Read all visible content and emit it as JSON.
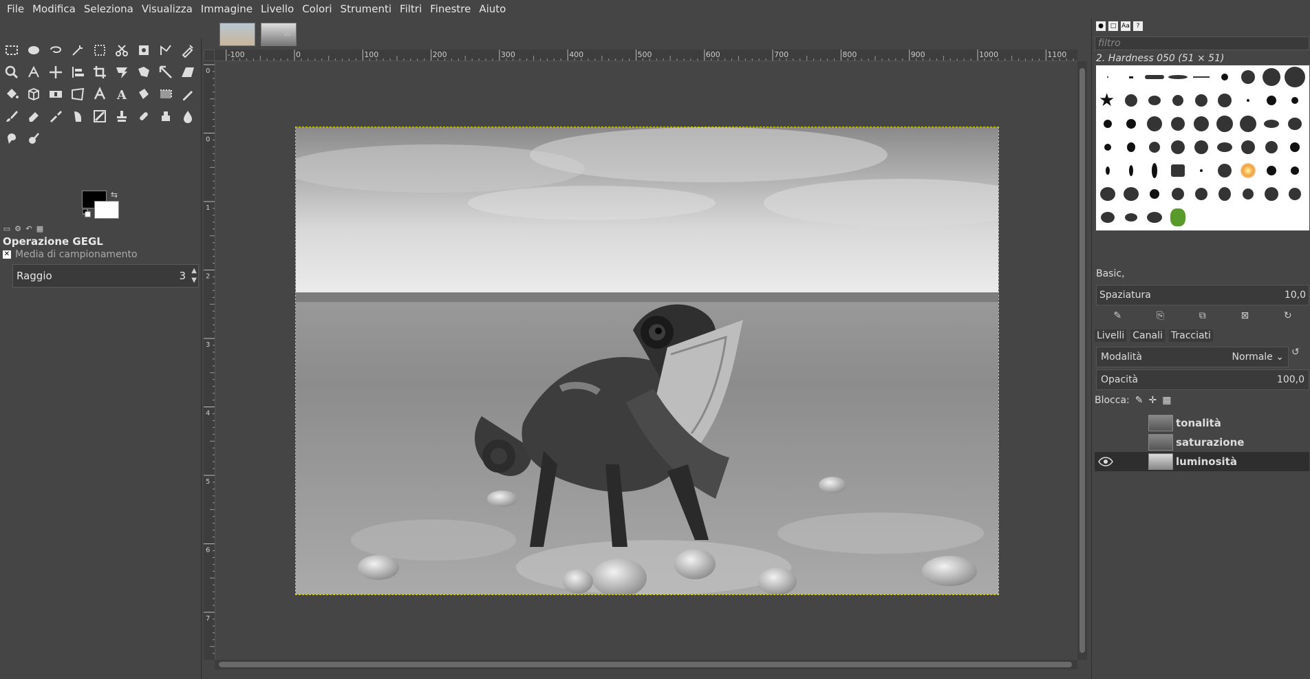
{
  "menu": [
    "File",
    "Modifica",
    "Seleziona",
    "Visualizza",
    "Immagine",
    "Livello",
    "Colori",
    "Strumenti",
    "Filtri",
    "Finestre",
    "Aiuto"
  ],
  "tool_options": {
    "title": "Operazione GEGL",
    "subtitle": "Media di campionamento",
    "radius_label": "Raggio",
    "radius_value": "3"
  },
  "ruler": {
    "h": [
      "-100",
      "0",
      "100",
      "200",
      "300",
      "400",
      "500",
      "600",
      "700",
      "800",
      "900",
      "1000",
      "1100"
    ],
    "v": [
      "0",
      "0",
      "1",
      "2",
      "3",
      "4",
      "5",
      "6",
      "7"
    ]
  },
  "brushes": {
    "filter_placeholder": "filtro",
    "selected": "2. Hardness 050 (51 × 51)",
    "preset": "Basic,",
    "spacing_label": "Spaziatura",
    "spacing_value": "10,0"
  },
  "layers": {
    "tabs": [
      "Livelli",
      "Canali",
      "Tracciati"
    ],
    "mode_label": "Modalità",
    "mode_value": "Normale",
    "opacity_label": "Opacità",
    "opacity_value": "100,0",
    "lock_label": "Blocca:",
    "items": [
      {
        "name": "tonalità",
        "visible": false
      },
      {
        "name": "saturazione",
        "visible": false
      },
      {
        "name": "luminosità",
        "visible": true
      }
    ]
  }
}
